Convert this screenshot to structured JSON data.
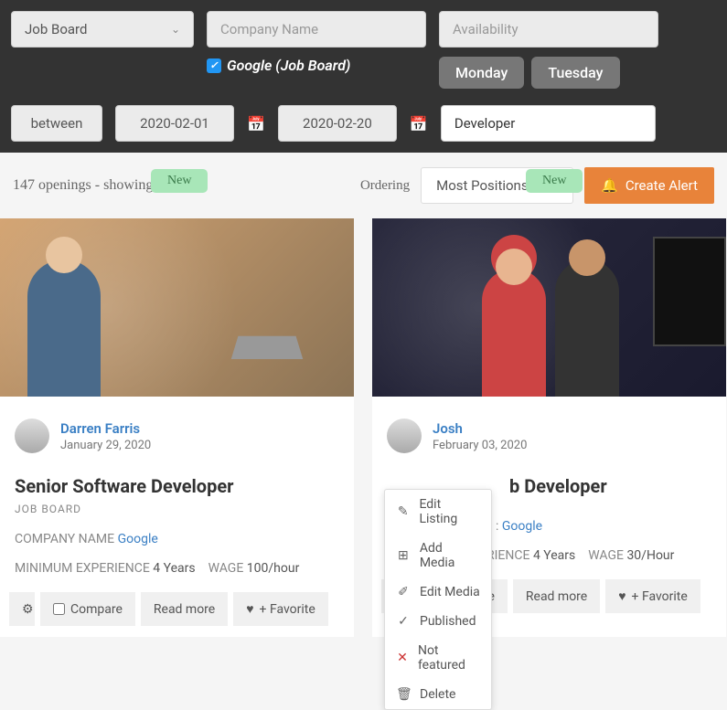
{
  "filters": {
    "category": "Job Board",
    "company_placeholder": "Company Name",
    "availability_placeholder": "Availability",
    "company_checked": "Google (Job Board)",
    "days": [
      "Monday",
      "Tuesday"
    ],
    "range_mode": "between",
    "date_from": "2020-02-01",
    "date_to": "2020-02-20",
    "keyword": "Developer"
  },
  "status": "147 openings - showing 1 - 5",
  "ordering_label": "Ordering",
  "ordering_value": "Most Positions",
  "create_alert": "Create Alert",
  "badge_new": "New",
  "meta_labels": {
    "company": "COMPANY NAME",
    "experience": "MINIMUM EXPERIENCE",
    "wage": "WAGE"
  },
  "actions": {
    "compare": "Compare",
    "read_more": "Read more",
    "favorite": "+ Favorite"
  },
  "cards": [
    {
      "author": "Darren Farris",
      "date": "January 29, 2020",
      "title": "Senior Software Developer",
      "category": "JOB BOARD",
      "company": "Google",
      "experience": "4 Years",
      "wage": "100/hour"
    },
    {
      "author": "Josh",
      "date": "February 03, 2020",
      "title": "b Developer",
      "category": "",
      "company": "Google",
      "experience": "4 Years",
      "wage": "30/Hour"
    }
  ],
  "exp_suffix": "RIENCE",
  "context_menu": {
    "edit_listing": "Edit Listing",
    "add_media": "Add Media",
    "edit_media": "Edit Media",
    "published": "Published",
    "not_featured": "Not featured",
    "delete": "Delete"
  }
}
